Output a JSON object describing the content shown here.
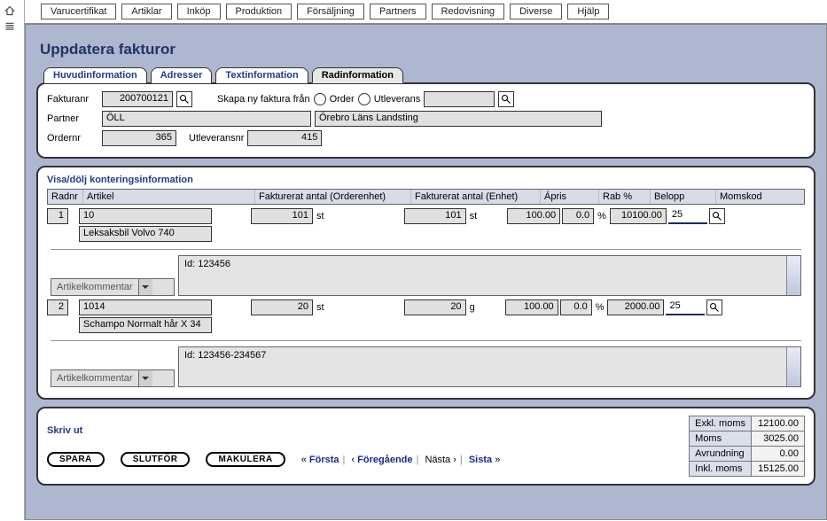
{
  "nav": {
    "tabs": [
      "Varucertifikat",
      "Artiklar",
      "Inköp",
      "Produktion",
      "Försäljning",
      "Partners",
      "Redovisning",
      "Diverse",
      "Hjälp"
    ]
  },
  "page": {
    "title": "Uppdatera fakturor"
  },
  "subtabs": {
    "t1": "Huvudinformation",
    "t2": "Adresser",
    "t3": "Textinformation",
    "t4": "Radinformation"
  },
  "header": {
    "fakturanr_lbl": "Fakturanr",
    "fakturanr": "200700121",
    "skapa_lbl": "Skapa ny faktura från",
    "order_lbl": "Order",
    "utleverans_lbl": "Utleverans",
    "partner_lbl": "Partner",
    "partner_code": "ÖLL",
    "partner_name": "Örebro Läns Landsting",
    "ordernr_lbl": "Ordernr",
    "ordernr": "365",
    "utleveransnr_lbl": "Utleveransnr",
    "utleveransnr": "415"
  },
  "grid": {
    "toggle": "Visa/dölj konteringsinformation",
    "headers": {
      "radnr": "Radnr",
      "artikel": "Artikel",
      "fakt_order": "Fakturerat antal (Orderenhet)",
      "fakt_enhet": "Fakturerat antal (Enhet)",
      "apris": "Ápris",
      "rab": "Rab %",
      "belopp": "Belopp",
      "momskod": "Momskod"
    },
    "combo_placeholder": "Artikelkommentar",
    "rows": [
      {
        "nr": "1",
        "art": "10",
        "artname": "Leksaksbil Volvo 740",
        "qty_order": "101",
        "unit_order": "st",
        "qty": "101",
        "unit": "st",
        "apris": "100.00",
        "rab": "0.0",
        "pct": "%",
        "belopp": "10100.00",
        "momskod": "25",
        "comment": "Id: 123456"
      },
      {
        "nr": "2",
        "art": "1014",
        "artname": "Schampo Normalt hår X 34",
        "qty_order": "20",
        "unit_order": "st",
        "qty": "20",
        "unit": "g",
        "apris": "100.00",
        "rab": "0.0",
        "pct": "%",
        "belopp": "2000.00",
        "momskod": "25",
        "comment": "Id: 123456-234567"
      }
    ]
  },
  "footer": {
    "print": "Skriv ut",
    "spara": "SPARA",
    "slutfor": "SLUTFÖR",
    "makulera": "MAKULERA",
    "pager": {
      "first": "Första",
      "prev": "Föregående",
      "next": "Nästa",
      "last": "Sista"
    },
    "totals": {
      "exkl_lbl": "Exkl. moms",
      "exkl": "12100.00",
      "moms_lbl": "Moms",
      "moms": "3025.00",
      "avr_lbl": "Avrundning",
      "avr": "0.00",
      "inkl_lbl": "Inkl. moms",
      "inkl": "15125.00"
    }
  }
}
